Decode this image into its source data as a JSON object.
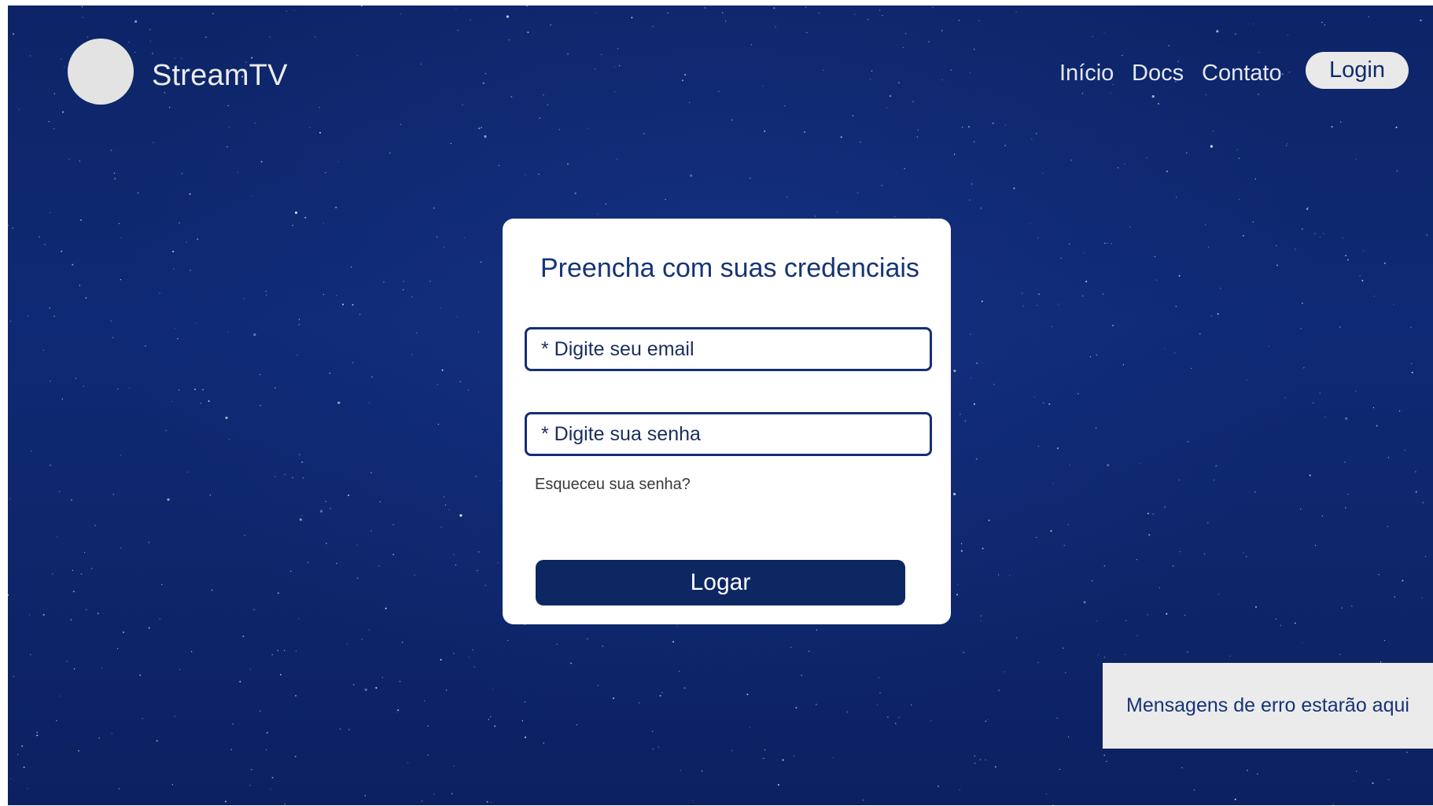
{
  "header": {
    "brand": "StreamTV",
    "nav": {
      "inicio": "Início",
      "docs": "Docs",
      "contato": "Contato"
    },
    "login_button": "Login"
  },
  "login_card": {
    "title": "Preencha com suas credenciais",
    "email_placeholder": "* Digite seu email",
    "password_placeholder": "* Digite sua senha",
    "forgot_link": "Esqueceu sua senha?",
    "submit_label": "Logar"
  },
  "error_panel": {
    "message": "Mensagens de erro estarão aqui"
  },
  "colors": {
    "background": "#0f2a74",
    "primary_dark": "#0d2763",
    "text_accent": "#163478",
    "card": "#ffffff",
    "logo_placeholder": "#e3e3e3"
  }
}
